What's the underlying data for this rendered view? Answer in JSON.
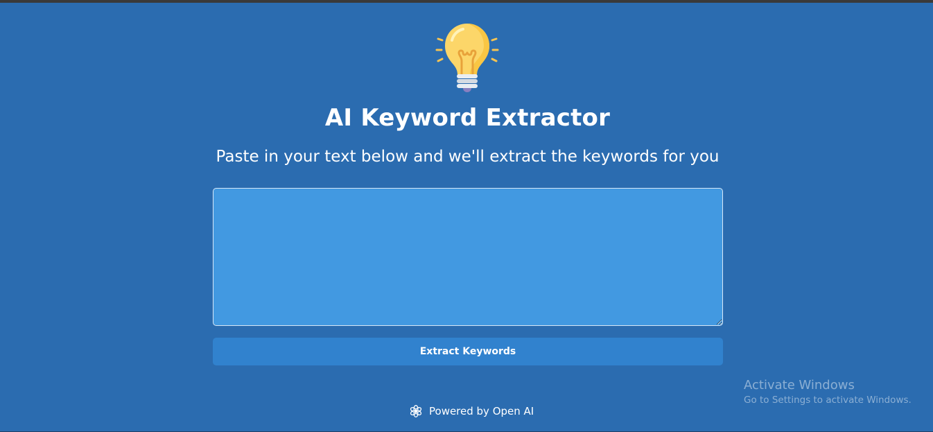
{
  "header": {
    "logo_icon": "lightbulb-icon",
    "title": "AI Keyword Extractor",
    "subtitle": "Paste in your text below and we'll extract the keywords for you"
  },
  "input": {
    "value": "",
    "placeholder": ""
  },
  "actions": {
    "extract_label": "Extract Keywords"
  },
  "footer": {
    "icon": "openai-icon",
    "powered_by": "Powered by Open AI"
  },
  "os_watermark": {
    "title": "Activate Windows",
    "subtitle": "Go to Settings to activate Windows."
  },
  "colors": {
    "background": "#2b6cb0",
    "textarea_bg": "#4299e1",
    "button_bg": "#3182ce",
    "text": "#ffffff"
  }
}
